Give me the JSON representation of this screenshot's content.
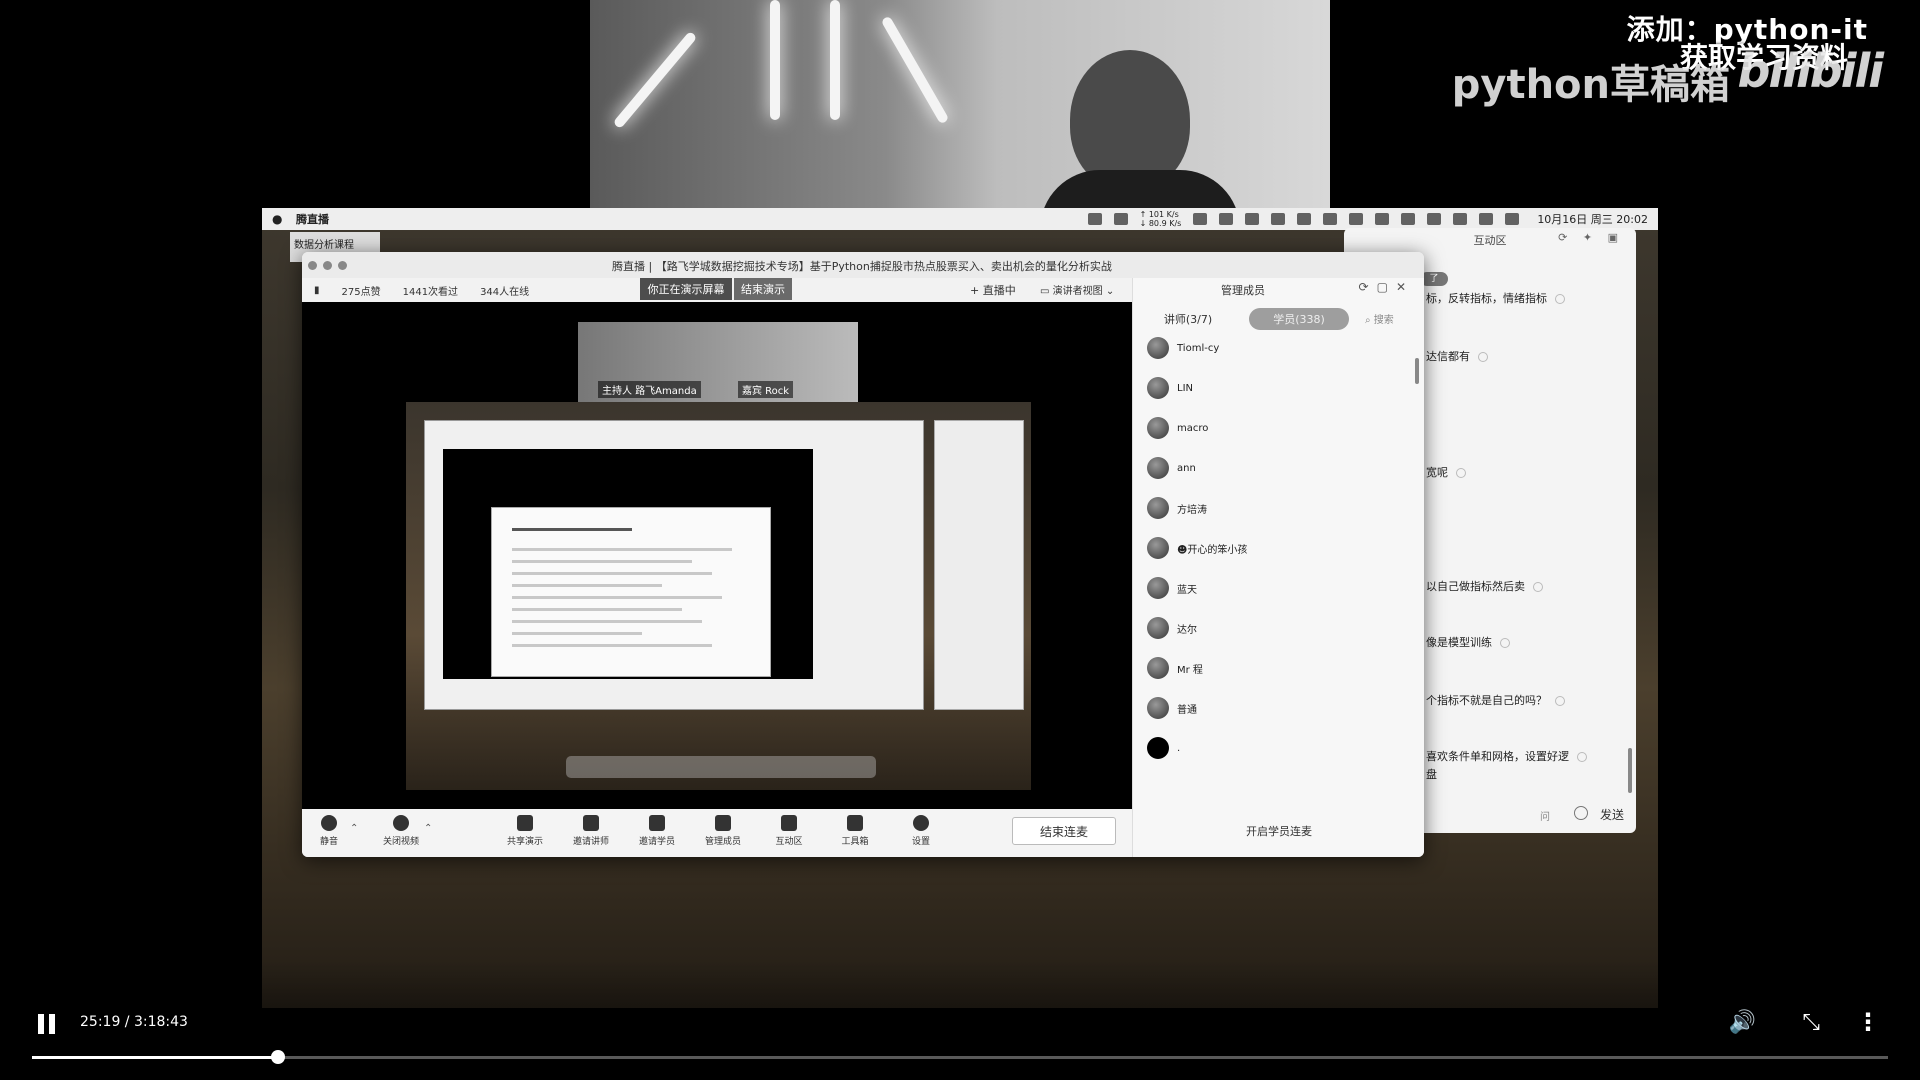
{
  "watermark": {
    "add_line": "添加：python-it",
    "get_line": "获取学习资料",
    "brand": "python草稿箱",
    "platform": "bilibili"
  },
  "menubar": {
    "app_name": "腾直播",
    "net_up": "↑ 101 K/s",
    "net_down": "↓ 80.9 K/s",
    "clock": "10月16日 周三 20:02"
  },
  "behind_panel": {
    "label": "数据分析课程"
  },
  "app": {
    "title": "腾直播 | 【路飞学城数据挖掘技术专场】基于Python捕捉股市热点股票买入、卖出机会的量化分析实战",
    "stats": {
      "likes": "275点赞",
      "views": "1441次看过",
      "online": "344人在线"
    },
    "presenting_badge": "你正在演示屏幕",
    "end_demo": "结束演示",
    "live_status": "直播中",
    "view_mode": "演讲者视图",
    "nested_cam": {
      "host_tag": "主持人  路飞Amanda",
      "guest_tag": "嘉宾  Rock"
    },
    "toolbar": {
      "mute": "静音",
      "close_video": "关闭视频",
      "share": "共享演示",
      "invite_lecturer": "邀请讲师",
      "invite_student": "邀请学员",
      "manage_members": "管理成员",
      "interaction": "互动区",
      "toolbox": "工具箱",
      "settings": "设置",
      "end_lianmai": "结束连麦"
    }
  },
  "members_panel": {
    "title": "管理成员",
    "tab_teacher": "讲师(3/7)",
    "tab_student": "学员(338)",
    "search": "搜索",
    "members": [
      {
        "name": "Tioml-cy"
      },
      {
        "name": "LIN"
      },
      {
        "name": "macro"
      },
      {
        "name": "ann"
      },
      {
        "name": "方培涛"
      },
      {
        "name": "☻开心的笨小孩"
      },
      {
        "name": "蓝天"
      },
      {
        "name": "达尔"
      },
      {
        "name": "Mr 程"
      },
      {
        "name": "普通"
      },
      {
        "name": "."
      }
    ],
    "open_lianmai": "开启学员连麦"
  },
  "interaction_panel": {
    "title": "互动区",
    "tag": "了",
    "messages": [
      "标，反转指标，情绪指标",
      "达信都有",
      "宽呢",
      "以自己做指标然后卖",
      "像是模型训练",
      "个指标不就是自己的吗？",
      "喜欢条件单和网格，设置好逻",
      "盘"
    ],
    "ask": "问",
    "send": "发送"
  },
  "player": {
    "time": "25:19 / 3:18:43",
    "progress": 0.1326
  },
  "icons": {
    "play": "pause-icon",
    "volume": "volume-icon",
    "fullscreen": "exit-fullscreen-icon",
    "more": "more-vertical-icon"
  }
}
